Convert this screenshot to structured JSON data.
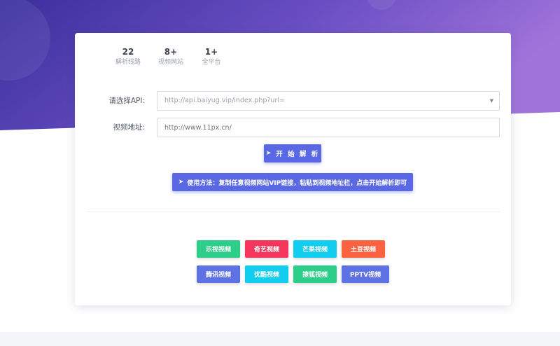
{
  "stats": [
    {
      "value": "22",
      "label": "解析线路"
    },
    {
      "value": "8+",
      "label": "视频网站"
    },
    {
      "value": "1+",
      "label": "全平台"
    }
  ],
  "form": {
    "api_label": "请选择API:",
    "api_value": "http://api.baiyug.vip/index.php?url=",
    "url_label": "视频地址:",
    "url_placeholder": "http://www.11px.cn/"
  },
  "buttons": {
    "parse": "开 始 解 析",
    "usage": "使用方法：复制任意视频网站VIP链接，粘贴到视频地址栏，点击开始解析即可"
  },
  "sites": [
    {
      "label": "乐视视频",
      "color": "#2dce89"
    },
    {
      "label": "奇艺视频",
      "color": "#f5365c"
    },
    {
      "label": "芒果视频",
      "color": "#11cdef"
    },
    {
      "label": "土豆视频",
      "color": "#fb6340"
    },
    {
      "label": "腾讯视频",
      "color": "#5e72e4"
    },
    {
      "label": "优酷视频",
      "color": "#11cdef"
    },
    {
      "label": "搜狐视频",
      "color": "#2dce89"
    },
    {
      "label": "PPTV视频",
      "color": "#5e72e4"
    }
  ],
  "colors": {
    "hero_start": "#3a2f9c",
    "hero_end": "#9a6fd8",
    "primary": "#5b68e4"
  }
}
